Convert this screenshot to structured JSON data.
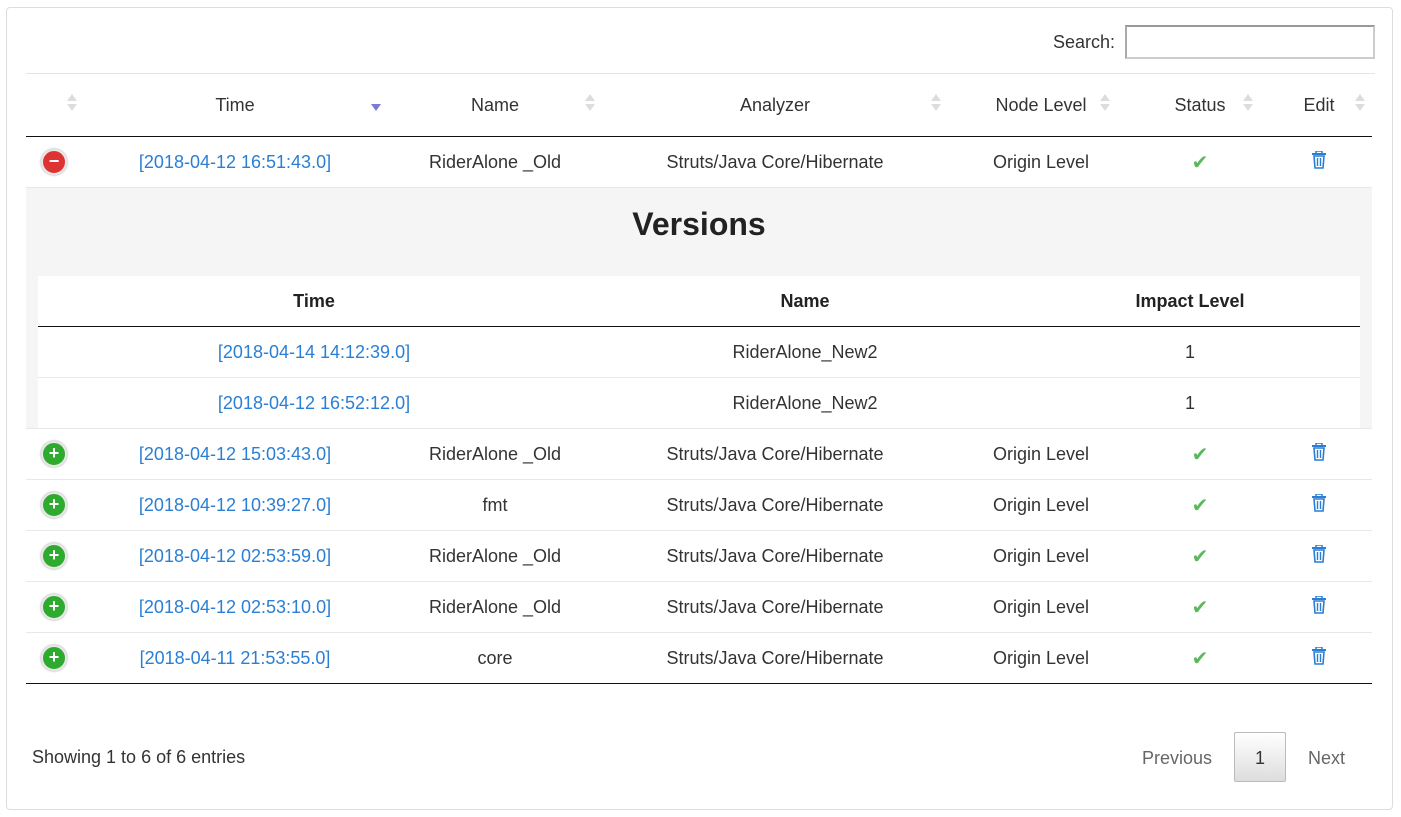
{
  "search": {
    "label": "Search:",
    "value": "",
    "placeholder": ""
  },
  "columns": {
    "time": "Time",
    "name": "Name",
    "analyzer": "Analyzer",
    "node_level": "Node Level",
    "status": "Status",
    "edit": "Edit"
  },
  "rows": [
    {
      "time": "[2018-04-12 16:51:43.0]",
      "name": "RiderAlone _Old",
      "analyzer": "Struts/Java Core/Hibernate",
      "node_level": "Origin Level",
      "expanded": true
    },
    {
      "time": "[2018-04-12 15:03:43.0]",
      "name": "RiderAlone _Old",
      "analyzer": "Struts/Java Core/Hibernate",
      "node_level": "Origin Level",
      "expanded": false
    },
    {
      "time": "[2018-04-12 10:39:27.0]",
      "name": "fmt",
      "analyzer": "Struts/Java Core/Hibernate",
      "node_level": "Origin Level",
      "expanded": false
    },
    {
      "time": "[2018-04-12 02:53:59.0]",
      "name": "RiderAlone _Old",
      "analyzer": "Struts/Java Core/Hibernate",
      "node_level": "Origin Level",
      "expanded": false
    },
    {
      "time": "[2018-04-12 02:53:10.0]",
      "name": "RiderAlone _Old",
      "analyzer": "Struts/Java Core/Hibernate",
      "node_level": "Origin Level",
      "expanded": false
    },
    {
      "time": "[2018-04-11 21:53:55.0]",
      "name": "core",
      "analyzer": "Struts/Java Core/Hibernate",
      "node_level": "Origin Level",
      "expanded": false
    }
  ],
  "versions": {
    "title": "Versions",
    "columns": {
      "time": "Time",
      "name": "Name",
      "impact": "Impact Level"
    },
    "rows": [
      {
        "time": "[2018-04-14 14:12:39.0]",
        "name": "RiderAlone_New2",
        "impact": "1"
      },
      {
        "time": "[2018-04-12 16:52:12.0]",
        "name": "RiderAlone_New2",
        "impact": "1"
      }
    ]
  },
  "footer": {
    "info": "Showing 1 to 6 of 6 entries",
    "previous": "Previous",
    "page": "1",
    "next": "Next"
  },
  "icons": {
    "collapse": "minus-circle-icon",
    "expand": "plus-circle-icon",
    "status": "check-icon",
    "edit": "trash-icon"
  },
  "colors": {
    "link": "#2a7fd4",
    "expand": "#2eaa2e",
    "collapse": "#dd3333",
    "check": "#5cb85c"
  }
}
